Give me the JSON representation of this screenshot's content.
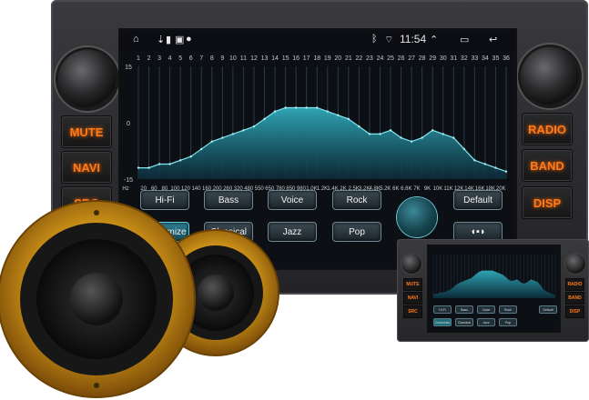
{
  "colors": {
    "accent": "#61cde0",
    "button_glow": "#ff7a1a",
    "curve_fill_top": "#2fa4b3",
    "curve_fill_bottom": "#0c2a38",
    "speaker_gold": "#d69a1a"
  },
  "statusbar": {
    "time": "11:54",
    "icons": [
      "home-icon",
      "usb-icon",
      "sd-icon",
      "image-icon",
      "record-icon",
      "bluetooth-icon",
      "wifi-icon",
      "up-arrow-icon",
      "multitask-icon",
      "back-icon"
    ]
  },
  "side_buttons": {
    "mute": "MUTE",
    "navi": "NAVI",
    "src": "SRC",
    "radio": "RADIO",
    "band": "BAND",
    "disp": "DISP"
  },
  "presets": {
    "hifi": "Hi-Fi",
    "bass": "Bass",
    "voice": "Voice",
    "rock": "Rock",
    "default": "Default",
    "customize": "Customize",
    "classical": "Classical",
    "jazz": "Jazz",
    "pop": "Pop",
    "selected": "Customize"
  },
  "chart_data": {
    "type": "area",
    "band_numbers": [
      "1",
      "2",
      "3",
      "4",
      "5",
      "6",
      "7",
      "8",
      "9",
      "10",
      "11",
      "12",
      "13",
      "14",
      "15",
      "16",
      "17",
      "18",
      "19",
      "20",
      "21",
      "22",
      "23",
      "24",
      "25",
      "26",
      "27",
      "28",
      "29",
      "30",
      "31",
      "32",
      "33",
      "34",
      "35",
      "36"
    ],
    "frequency_labels": [
      "Hz",
      "20",
      "60",
      "80",
      "100",
      "120",
      "140",
      "160",
      "200",
      "260",
      "320",
      "480",
      "550",
      "650",
      "780",
      "850",
      "980",
      "1.0K",
      "1.2K",
      "1.4K",
      "2K",
      "2.5K",
      "3.2K",
      "4.8K",
      "5.2K",
      "6K",
      "6.8K",
      "7K",
      "9K",
      "10K",
      "11K",
      "12K",
      "14K",
      "16K",
      "18K",
      "20K"
    ],
    "y_ticks": [
      "15",
      "0",
      "-15"
    ],
    "ylim": [
      -15,
      15
    ],
    "values": [
      -12,
      -12,
      -11,
      -11,
      -10,
      -9,
      -7,
      -5,
      -4,
      -3,
      -2,
      -1,
      1,
      3,
      4,
      4,
      4,
      4,
      3,
      2,
      1,
      -1,
      -3,
      -3,
      -2,
      -4,
      -5,
      -4,
      -2,
      -3,
      -4,
      -7,
      -10,
      -11,
      -12,
      -13
    ]
  },
  "mini": {
    "side_buttons": {
      "mute": "MUTE",
      "navi": "NAVI",
      "src": "SRC",
      "radio": "RADIO",
      "band": "BAND",
      "disp": "DISP"
    }
  }
}
